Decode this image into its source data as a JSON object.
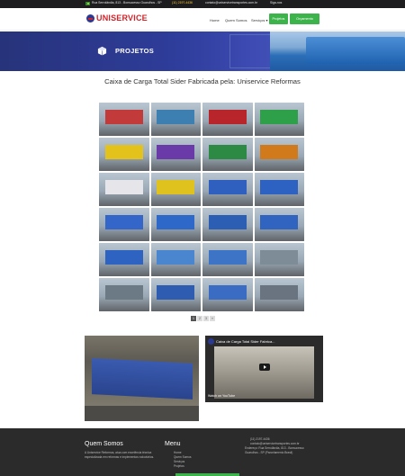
{
  "topbar": {
    "address": "Rua Serrolândia, 813 - Bonsucesso Guarulhos - SP",
    "phone": "(11) 2197-4436",
    "email": "contato@uniservicetransportes.com.br",
    "social": "Siga-nos"
  },
  "header": {
    "logo": "UNISERVICE",
    "nav": [
      "Home",
      "Quem Somos",
      "Serviços ▾"
    ],
    "buttons": [
      "Projetos",
      "Orçamento"
    ]
  },
  "banner": {
    "title": "PROJETOS",
    "colors": {
      "primary": "#2f3d9c",
      "accent": "#d2232a",
      "green": "#3cb44b"
    }
  },
  "page": {
    "title": "Caixa de Carga Total Sider Fabricada pela: Uniservice Reformas"
  },
  "gallery": {
    "thumb_colors": [
      [
        "#c23a3a",
        "#3d7fb0",
        "#b8262b",
        "#2fa04a"
      ],
      [
        "#e3c21c",
        "#6a3aa8",
        "#2c8a44",
        "#d07a1c"
      ],
      [
        "#e6e6ea",
        "#e0c21e",
        "#2f5fbf",
        "#2d62c2"
      ],
      [
        "#3366c8",
        "#2e68c8",
        "#2c5fb4",
        "#3064c0"
      ],
      [
        "#2f63c1",
        "#4a86cf",
        "#3d74c6",
        "#7d8c96"
      ],
      [
        "#6c7a86",
        "#2e5cb0",
        "#3a6cc4",
        "#6a7480"
      ]
    ],
    "pages": [
      "1",
      "2",
      "3",
      "»"
    ],
    "active_page": 0
  },
  "video": {
    "title": "Caixa de Carga Total Sider Fabrica...",
    "watch_on": "Watch on YouTube"
  },
  "footer": {
    "about_heading": "Quem Somos",
    "about_text": "A Uniservice Reformas, atua com excelência técnica especializada em reformas e implementos rodoviários.",
    "menu_heading": "Menu",
    "menu_items": [
      "Home",
      "Quem Somos",
      "Serviços",
      "Projetos"
    ],
    "contact_phone": "(11) 2197-4436",
    "contact_email": "contato@uniservicetransportes.com.br",
    "contact_address": "Endereço: Rua Serrolândia, 813 - Bonsucesso Guarulhos - SP (Parcelamento Brasil)"
  }
}
